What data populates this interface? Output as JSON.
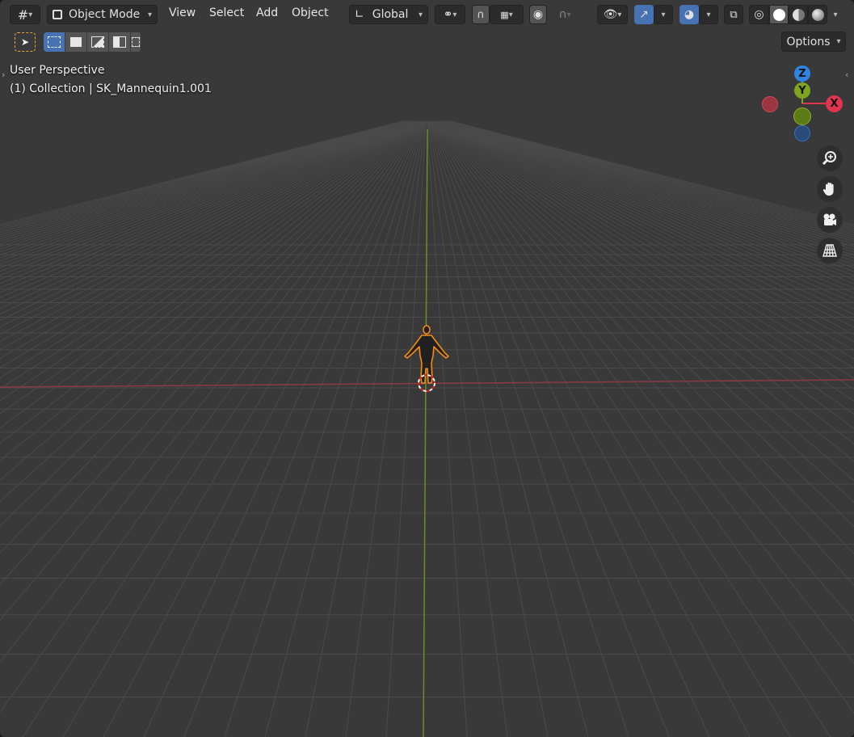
{
  "header": {
    "editor_icon": "grid-icon",
    "mode_label": "Object Mode",
    "menus": [
      "View",
      "Select",
      "Add",
      "Object"
    ],
    "transform_orientation": "Global",
    "options_label": "Options"
  },
  "overlay": {
    "view_name": "User Perspective",
    "collection_info": "(1) Collection | SK_Mannequin1.001"
  },
  "gizmo": {
    "z_label": "Z",
    "y_label": "Y",
    "x_label": "X"
  },
  "nav_buttons": [
    "zoom-icon",
    "hand-icon",
    "camera-icon",
    "grid-perspective-icon"
  ],
  "colors": {
    "accent": "#4772b3",
    "x_axis": "#e0344f",
    "y_axis": "#7da51f",
    "z_axis": "#2f84e3",
    "selection_outline": "#f28c13"
  }
}
